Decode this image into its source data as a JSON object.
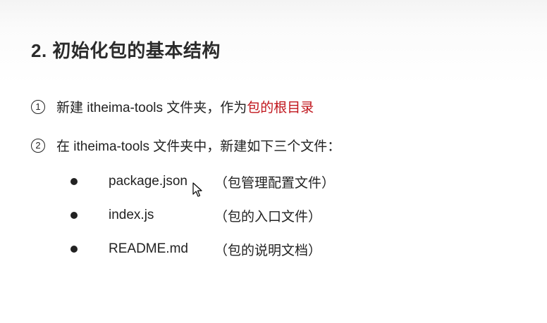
{
  "slide": {
    "title": "2. 初始化包的基本结构",
    "steps": [
      {
        "number": "1",
        "text": "新建 itheima-tools 文件夹，作为",
        "highlight": "包的根目录"
      },
      {
        "number": "2",
        "text": "在 itheima-tools 文件夹中，新建如下三个文件："
      }
    ],
    "files": [
      {
        "name": "package.json",
        "desc": "（包管理配置文件）"
      },
      {
        "name": "index.js",
        "desc": "（包的入口文件）"
      },
      {
        "name": "README.md",
        "desc": "（包的说明文档）"
      }
    ],
    "colors": {
      "highlight": "#c0141b",
      "text": "#222222"
    },
    "icons": {
      "cursor": "mouse-pointer-icon",
      "bullet": "filled-circle-bullet"
    }
  }
}
